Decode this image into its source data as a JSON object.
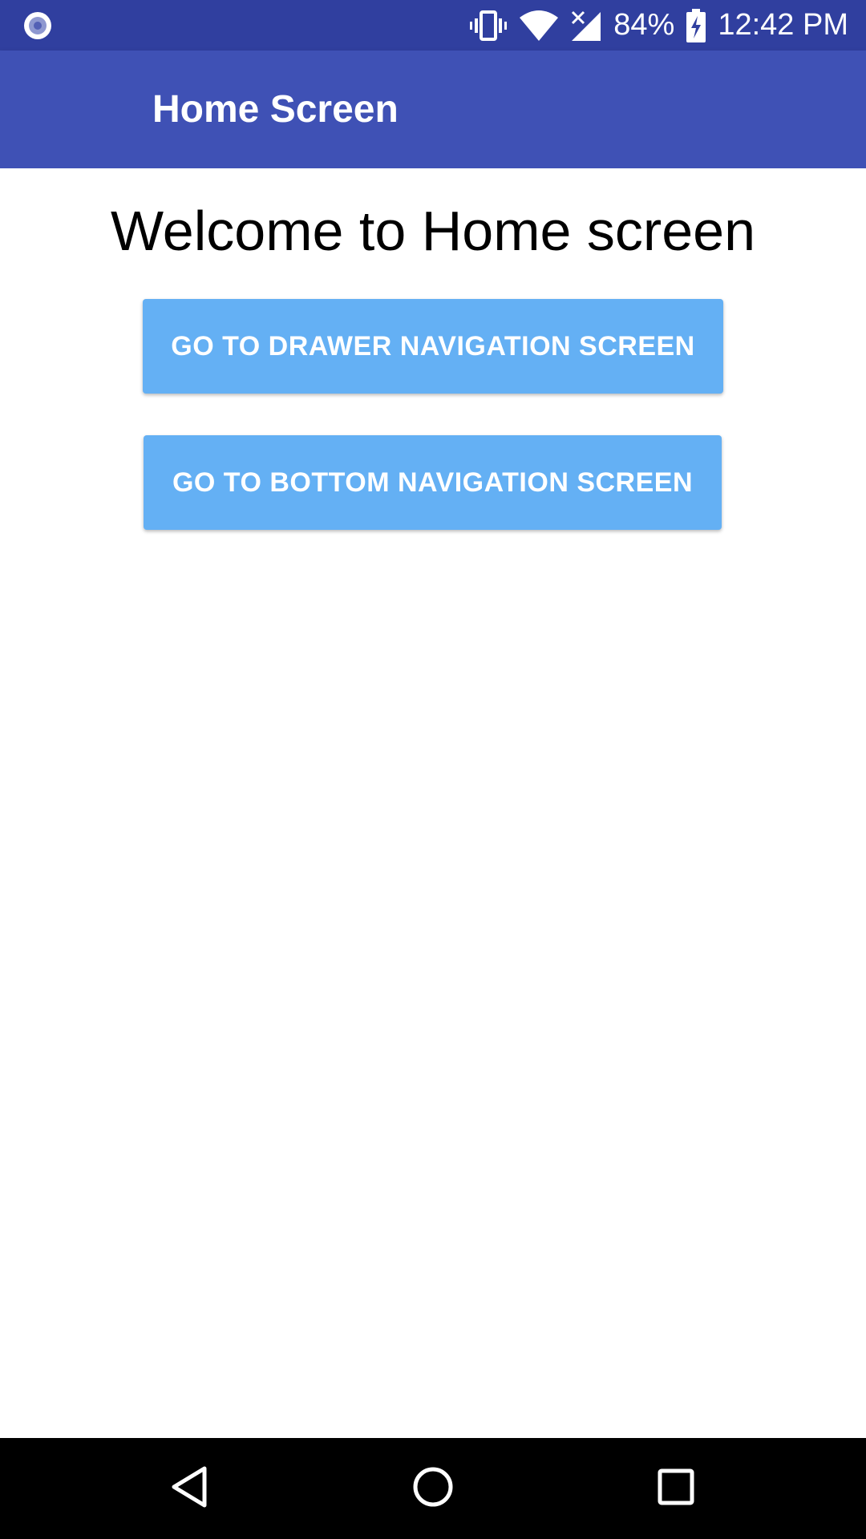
{
  "status_bar": {
    "left_icon": "record-circle-icon",
    "icons": [
      "vibrate-icon",
      "wifi-icon",
      "cell-signal-no-data-icon"
    ],
    "battery_percent": "84%",
    "battery_icon": "battery-charging-icon",
    "time": "12:42 PM"
  },
  "app_bar": {
    "title": "Home Screen"
  },
  "content": {
    "welcome": "Welcome to Home screen",
    "buttons": {
      "drawer": "GO TO DRAWER NAVIGATION SCREEN",
      "bottom": "GO TO BOTTOM NAVIGATION SCREEN"
    }
  },
  "nav_bar": {
    "keys": [
      "back-icon",
      "home-icon",
      "recents-icon"
    ]
  },
  "colors": {
    "status_bar": "#303f9f",
    "app_bar": "#3f51b5",
    "button": "#64b0f4",
    "button_text": "#ffffff",
    "nav_bar": "#000000"
  }
}
